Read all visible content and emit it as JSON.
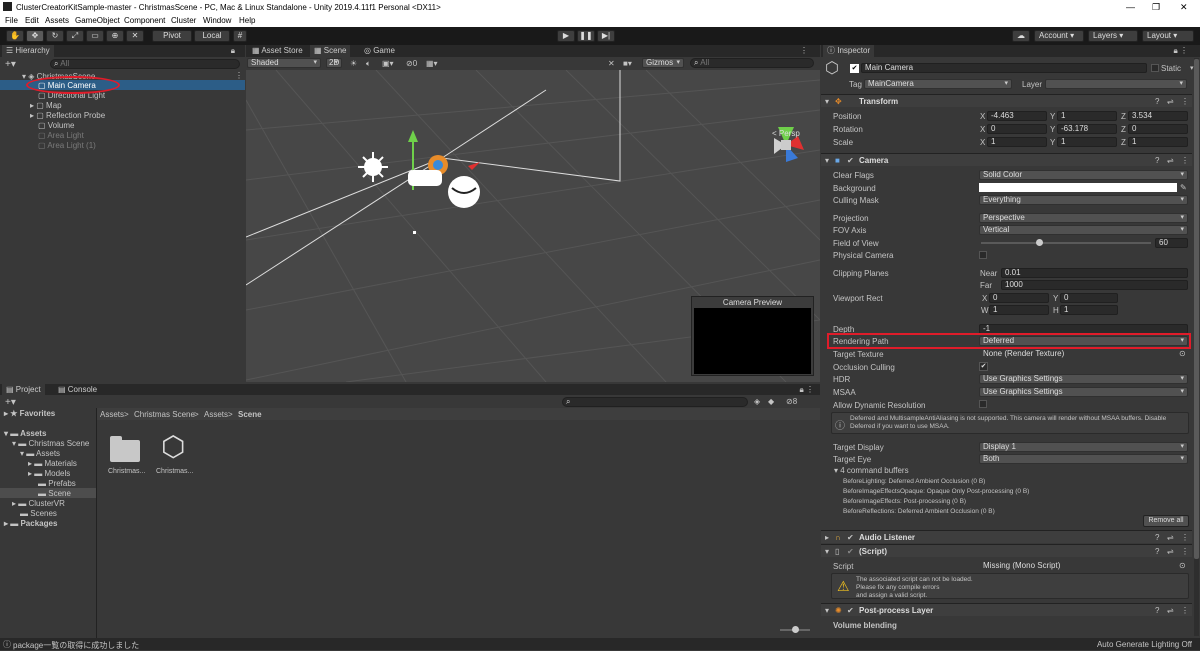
{
  "window": {
    "title": "ClusterCreatorKitSample-master - ChristmasScene - PC, Mac & Linux Standalone - Unity 2019.4.11f1 Personal <DX11>"
  },
  "menu": [
    "File",
    "Edit",
    "Assets",
    "GameObject",
    "Component",
    "Cluster",
    "Window",
    "Help"
  ],
  "toolbar": {
    "pivot": "Pivot",
    "local": "Local",
    "account": "Account",
    "layers": "Layers",
    "layout": "Layout"
  },
  "hierarchy": {
    "tab": "Hierarchy",
    "search_placeholder": "All",
    "scene": "ChristmasScene",
    "items": [
      "Main Camera",
      "Directional Light",
      "Map",
      "Reflection Probe",
      "Volume",
      "Area Light",
      "Area Light (1)"
    ]
  },
  "scene": {
    "tabs": [
      "Asset Store",
      "Scene",
      "Game"
    ],
    "shading": "Shaded",
    "mode2d": "2D",
    "gizmos": "Gizmos",
    "search_placeholder": "All",
    "persp": "< Persp",
    "hidden_count": "0",
    "preview_title": "Camera Preview"
  },
  "project": {
    "tabs": [
      "Project",
      "Console"
    ],
    "favorites": "Favorites",
    "tree": [
      "Assets",
      "Christmas Scene",
      "Assets",
      "Materials",
      "Models",
      "Prefabs",
      "Scene",
      "ClusterVR",
      "Scenes",
      "Packages"
    ],
    "breadcrumb": [
      "Assets",
      "Christmas Scene",
      "Assets",
      "Scene"
    ],
    "files": [
      "Christmas...",
      "Christmas..."
    ],
    "count": "8"
  },
  "status": {
    "message": "package一覧の取得に成功しました",
    "lighting": "Auto Generate Lighting Off"
  },
  "inspector": {
    "tab": "Inspector",
    "name": "Main Camera",
    "static": "Static",
    "tag_label": "Tag",
    "tag": "MainCamera",
    "layer_label": "Layer",
    "transform": {
      "title": "Transform",
      "position": "Position",
      "rotation": "Rotation",
      "scale": "Scale",
      "px": "-4.463",
      "py": "1",
      "pz": "3.534",
      "rx": "0",
      "ry": "-63.178",
      "rz": "0",
      "sx": "1",
      "sy": "1",
      "sz": "1"
    },
    "camera": {
      "title": "Camera",
      "clear_flags_l": "Clear Flags",
      "clear_flags": "Solid Color",
      "background_l": "Background",
      "culling_l": "Culling Mask",
      "culling": "Everything",
      "projection_l": "Projection",
      "projection": "Perspective",
      "fov_axis_l": "FOV Axis",
      "fov_axis": "Vertical",
      "fov_l": "Field of View",
      "fov": "60",
      "physical_l": "Physical Camera",
      "clipping_l": "Clipping Planes",
      "near_l": "Near",
      "near": "0.01",
      "far_l": "Far",
      "far": "1000",
      "viewport_l": "Viewport Rect",
      "vx": "0",
      "vy": "0",
      "vw": "1",
      "vh": "1",
      "depth_l": "Depth",
      "depth": "-1",
      "rendering_l": "Rendering Path",
      "rendering": "Deferred",
      "target_tex_l": "Target Texture",
      "target_tex": "None (Render Texture)",
      "occlusion_l": "Occlusion Culling",
      "hdr_l": "HDR",
      "hdr": "Use Graphics Settings",
      "msaa_l": "MSAA",
      "msaa": "Use Graphics Settings",
      "dynres_l": "Allow Dynamic Resolution",
      "warning": "Deferred and MultisampleAntiAliasing is not supported. This camera will render without MSAA buffers. Disable Deferred if you want to use MSAA.",
      "display_l": "Target Display",
      "display": "Display 1",
      "eye_l": "Target Eye",
      "eye": "Both",
      "buffers": "4 command buffers",
      "buffer_list": [
        "BeforeLighting: Deferred Ambient Occlusion (0 B)",
        "BeforeImageEffectsOpaque: Opaque Only Post-processing (0 B)",
        "BeforeImageEffects: Post-processing (0 B)",
        "BeforeReflections: Deferred Ambient Occlusion (0 B)"
      ],
      "remove_all": "Remove all"
    },
    "audio": {
      "title": "Audio Listener"
    },
    "script": {
      "title": "(Script)",
      "label": "Script",
      "value": "Missing (Mono Script)",
      "warning_lines": [
        "The associated script can not be loaded.",
        "Please fix any compile errors",
        "and assign a valid script."
      ]
    },
    "postprocess": {
      "title": "Post-process Layer",
      "volume_blending": "Volume blending"
    }
  }
}
